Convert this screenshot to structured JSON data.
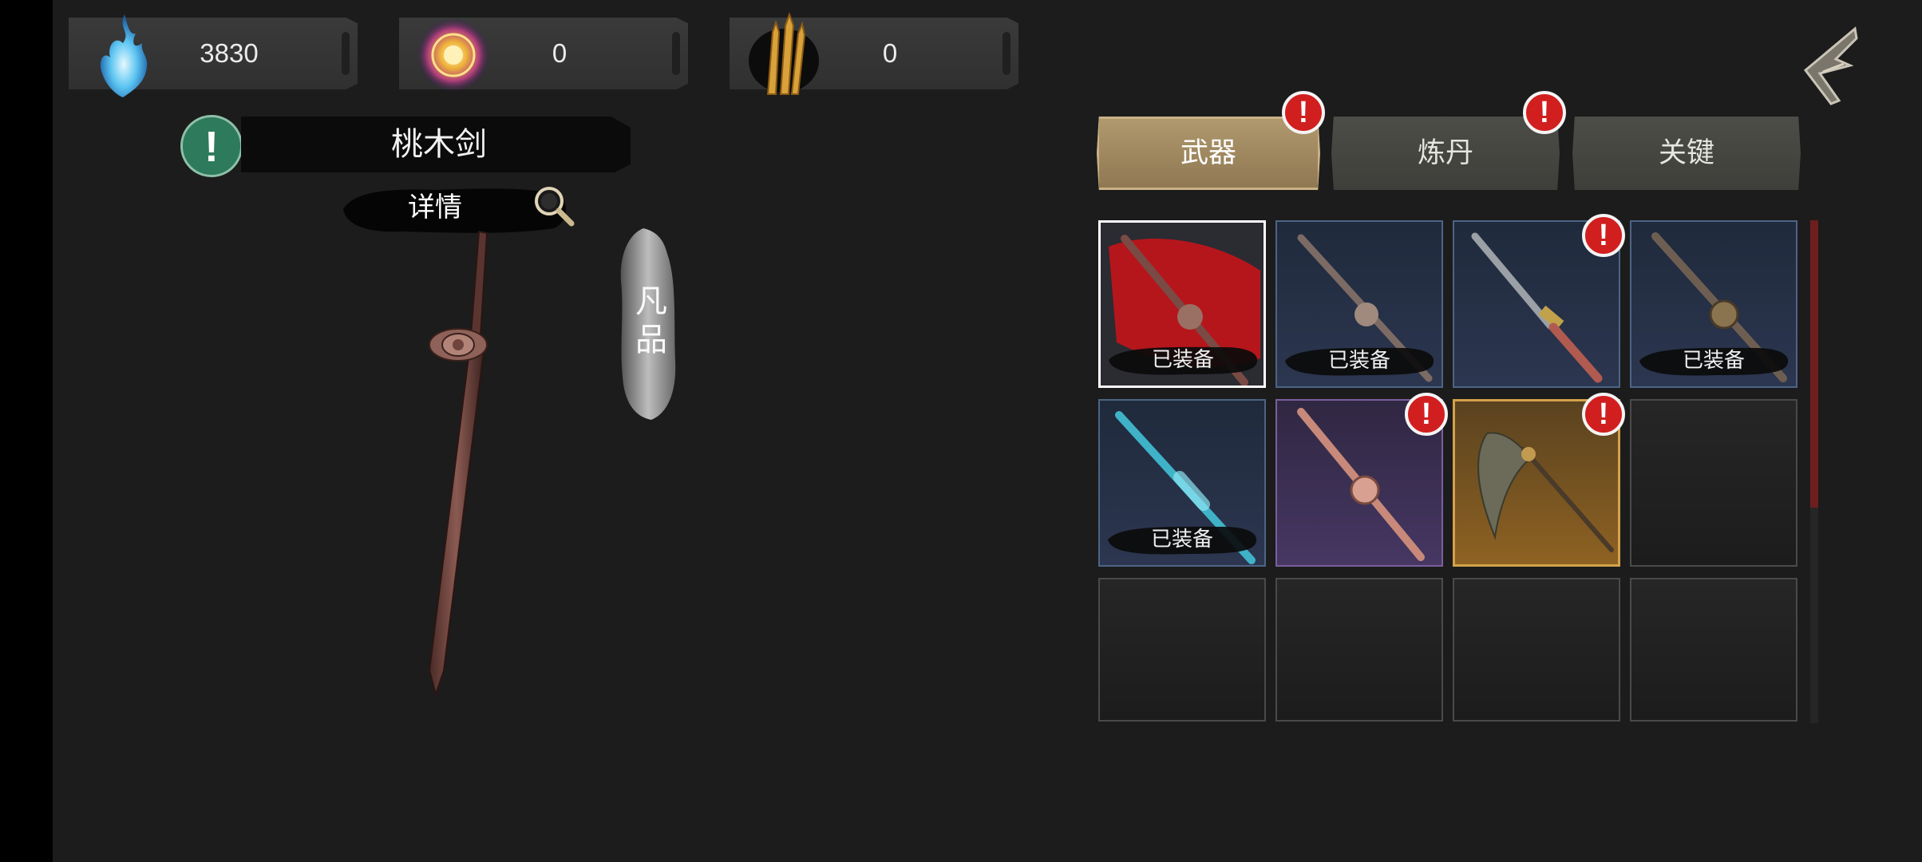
{
  "currencies": [
    {
      "icon": "blue-spirit-flame-icon",
      "value": "3830"
    },
    {
      "icon": "golden-orb-icon",
      "value": "0"
    },
    {
      "icon": "golden-talisman-icon",
      "value": "0"
    }
  ],
  "weapon": {
    "name": "桃木剑",
    "details_label": "详情",
    "grade": "凡品"
  },
  "tabs": [
    {
      "label": "武器",
      "active": true,
      "notice": true
    },
    {
      "label": "炼丹",
      "active": false,
      "notice": true
    },
    {
      "label": "关键",
      "active": false,
      "notice": false
    }
  ],
  "inventory": {
    "equipped_label": "已装备",
    "slots": [
      {
        "item": "peach-wood-sword",
        "rarity": "selected",
        "equipped": true,
        "notice": false
      },
      {
        "item": "bronze-sword",
        "rarity": "blue",
        "equipped": true,
        "notice": false
      },
      {
        "item": "gold-hilt-sword",
        "rarity": "blue",
        "equipped": false,
        "notice": true
      },
      {
        "item": "ornate-sword",
        "rarity": "blue",
        "equipped": true,
        "notice": false
      },
      {
        "item": "crystal-sword",
        "rarity": "blue",
        "equipped": true,
        "notice": false
      },
      {
        "item": "copper-sword",
        "rarity": "purple",
        "equipped": false,
        "notice": true
      },
      {
        "item": "horsetail-whisk",
        "rarity": "gold",
        "equipped": false,
        "notice": true
      },
      {
        "item": "empty",
        "rarity": "empty"
      },
      {
        "item": "empty",
        "rarity": "empty"
      },
      {
        "item": "empty",
        "rarity": "empty"
      },
      {
        "item": "empty",
        "rarity": "empty"
      },
      {
        "item": "empty",
        "rarity": "empty"
      }
    ]
  },
  "colors": {
    "notice": "#d11f1f",
    "active_tab": "#a88f62",
    "alert": "#2e7a5c"
  }
}
